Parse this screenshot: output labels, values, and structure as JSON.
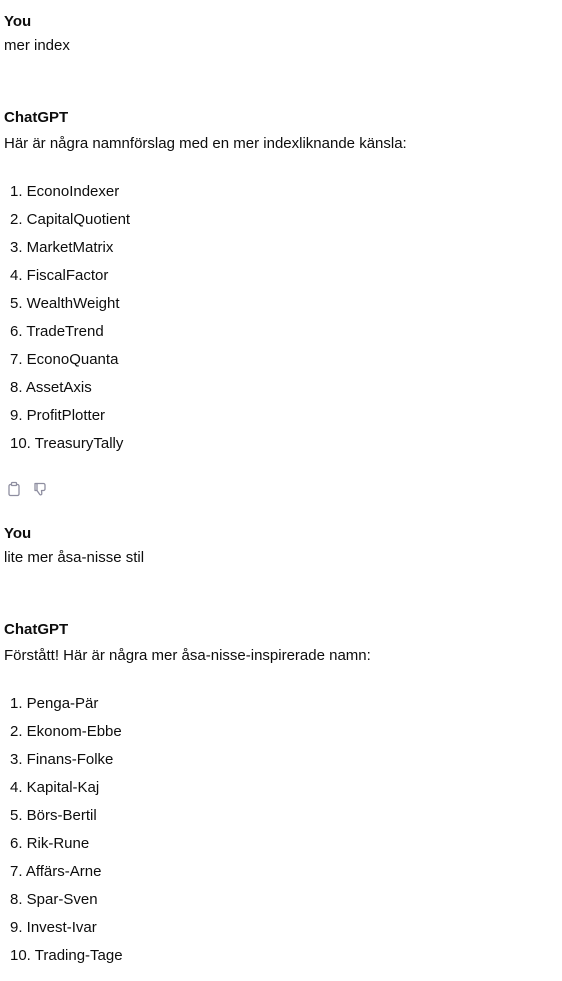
{
  "messages": [
    {
      "speaker": "You",
      "text": "mer index"
    },
    {
      "speaker": "ChatGPT",
      "intro": "Här är några namnförslag med en mer indexliknande känsla:",
      "items": [
        "1. EconoIndexer",
        "2. CapitalQuotient",
        "3. MarketMatrix",
        "4. FiscalFactor",
        "5. WealthWeight",
        "6. TradeTrend",
        "7. EconoQuanta",
        "8. AssetAxis",
        "9. ProfitPlotter",
        "10. TreasuryTally"
      ],
      "actions": [
        "copy-icon",
        "thumbs-down-icon"
      ]
    },
    {
      "speaker": "You",
      "text": "lite mer åsa-nisse stil"
    },
    {
      "speaker": "ChatGPT",
      "intro": "Förstått! Här är några mer åsa-nisse-inspirerade namn:",
      "items": [
        "1. Penga-Pär",
        "2. Ekonom-Ebbe",
        "3. Finans-Folke",
        "4. Kapital-Kaj",
        "5. Börs-Bertil",
        "6. Rik-Rune",
        "7. Affärs-Arne",
        "8. Spar-Sven",
        "9. Invest-Ivar",
        "10. Trading-Tage"
      ]
    }
  ],
  "colors": {
    "text": "#0d0d0d",
    "icon": "#8e8ea0",
    "background": "#ffffff"
  }
}
